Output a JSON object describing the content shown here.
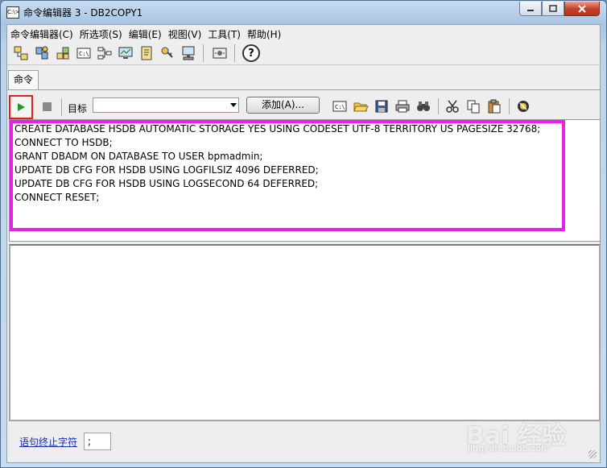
{
  "window": {
    "title": "命令编辑器 3 - DB2COPY1",
    "title_icon": "C:\\>"
  },
  "menu": [
    {
      "label": "命令编辑器(C)"
    },
    {
      "label": "所选项(S)"
    },
    {
      "label": "编辑(E)"
    },
    {
      "label": "视图(V)"
    },
    {
      "label": "工具(T)"
    },
    {
      "label": "帮助(H)"
    }
  ],
  "toolbar": {
    "help_glyph": "?"
  },
  "tabs": [
    {
      "label": "命令"
    }
  ],
  "command_toolbar": {
    "target_label": "目标",
    "target_value": "",
    "add_button": "添加(A)..."
  },
  "editor": {
    "lines": [
      "CREATE DATABASE HSDB AUTOMATIC STORAGE YES USING CODESET UTF-8 TERRITORY US PAGESIZE 32768;",
      "CONNECT TO HSDB;",
      "GRANT DBADM ON DATABASE TO USER bpmadmin;",
      "UPDATE DB CFG FOR HSDB USING LOGFILSIZ 4096 DEFERRED;",
      "UPDATE DB CFG FOR HSDB USING LOGSECOND 64 DEFERRED;",
      "CONNECT RESET;"
    ]
  },
  "terminator": {
    "link_label": "语句终止字符",
    "value": ";"
  },
  "watermark": {
    "text": "Bai 经验",
    "sub": "jingyan.baidu.com"
  },
  "colors": {
    "highlight": "#ea1fea",
    "run_highlight": "#e0201b",
    "run_icon": "#1f9a28"
  }
}
